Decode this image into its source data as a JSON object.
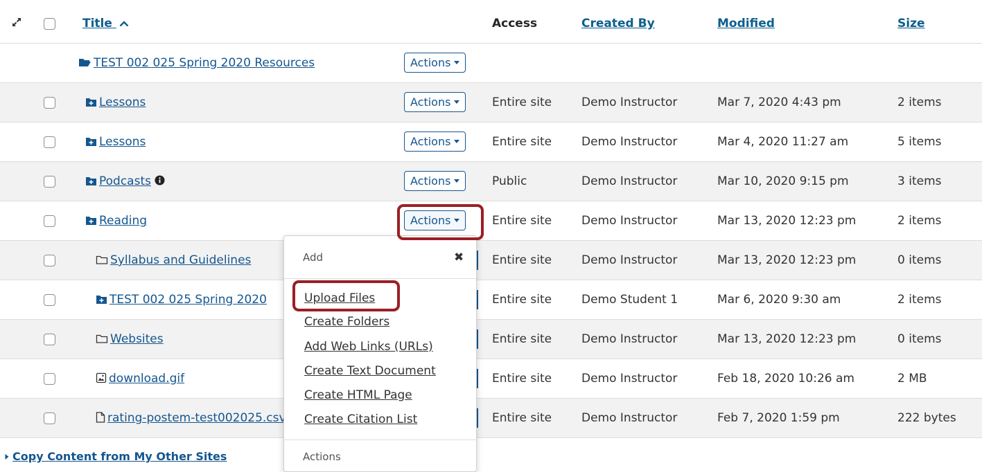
{
  "header": {
    "expand_icon": "expand-arrows-icon",
    "title_label": "Title",
    "title_sort_icon": "chevron-up-icon",
    "access_label": "Access",
    "created_by_label": "Created By",
    "modified_label": "Modified",
    "size_label": "Size"
  },
  "root_folder": {
    "title": "TEST 002 025 Spring 2020 Resources",
    "icon": "folder-open-icon",
    "actions_label": "Actions"
  },
  "rows": [
    {
      "title": "Lessons",
      "icon": "folder-plus-icon",
      "actions_label": "Actions",
      "access": "Entire site",
      "created_by": "Demo Instructor",
      "modified": "Mar 7, 2020 4:43 pm",
      "size": "2 items"
    },
    {
      "title": "Lessons",
      "icon": "folder-plus-icon",
      "actions_label": "Actions",
      "access": "Entire site",
      "created_by": "Demo Instructor",
      "modified": "Mar 4, 2020 11:27 am",
      "size": "5 items"
    },
    {
      "title": "Podcasts",
      "icon": "folder-plus-icon",
      "info_icon": "info-circle-icon",
      "actions_label": "Actions",
      "access": "Public",
      "created_by": "Demo Instructor",
      "modified": "Mar 10, 2020 9:15 pm",
      "size": "3 items"
    },
    {
      "title": "Reading",
      "icon": "folder-plus-icon",
      "actions_label": "Actions",
      "access": "Entire site",
      "created_by": "Demo Instructor",
      "modified": "Mar 13, 2020 12:23 pm",
      "size": "2 items"
    },
    {
      "title": "Syllabus and Guidelines",
      "icon": "folder-outline-icon",
      "access": "Entire site",
      "created_by": "Demo Instructor",
      "modified": "Mar 13, 2020 12:23 pm",
      "size": "0 items"
    },
    {
      "title": "TEST 002 025 Spring 2020",
      "icon": "folder-plus-icon",
      "access": "Entire site",
      "created_by": "Demo Student 1",
      "modified": "Mar 6, 2020 9:30 am",
      "size": "2 items"
    },
    {
      "title": "Websites",
      "icon": "folder-outline-icon",
      "access": "Entire site",
      "created_by": "Demo Instructor",
      "modified": "Mar 13, 2020 12:23 pm",
      "size": "0 items"
    },
    {
      "title": "download.gif",
      "icon": "image-file-icon",
      "access": "Entire site",
      "created_by": "Demo Instructor",
      "modified": "Feb 18, 2020 10:26 am",
      "size": "2 MB"
    },
    {
      "title": "rating-postem-test002025.csv",
      "icon": "file-icon",
      "access": "Entire site",
      "created_by": "Demo Instructor",
      "modified": "Feb 7, 2020 1:59 pm",
      "size": "222 bytes"
    }
  ],
  "dropdown": {
    "section_add": "Add",
    "close_icon": "close-icon",
    "items": [
      "Upload Files",
      "Create Folders",
      "Add Web Links (URLs)",
      "Create Text Document",
      "Create HTML Page",
      "Create Citation List"
    ],
    "section_actions": "Actions"
  },
  "footer": {
    "copy_link": "Copy Content from My Other Sites",
    "caret_icon": "caret-right-icon"
  },
  "colors": {
    "link": "#15568f",
    "highlight": "#9b1f24",
    "stripe": "#f2f2f2"
  }
}
